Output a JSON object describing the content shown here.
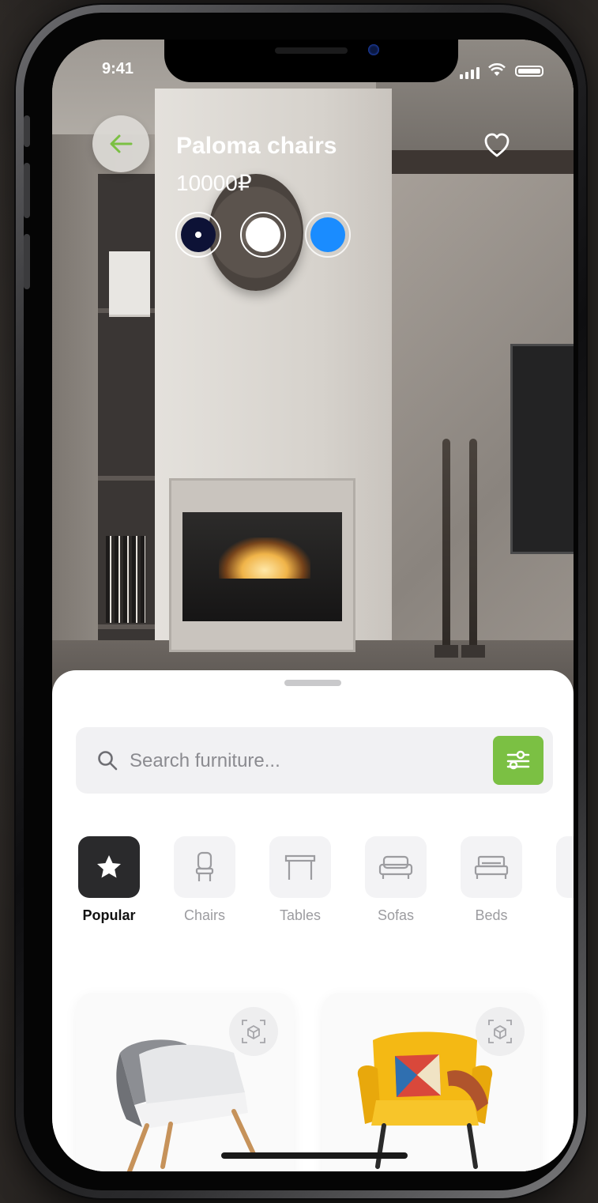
{
  "status_bar": {
    "time": "9:41"
  },
  "product": {
    "title": "Paloma chairs",
    "price": "10000₽",
    "colors": [
      {
        "name": "navy",
        "hex": "#0d1236",
        "selected": true
      },
      {
        "name": "white",
        "hex": "#ffffff",
        "selected": false
      },
      {
        "name": "blue",
        "hex": "#1a8cff",
        "selected": false
      }
    ]
  },
  "search": {
    "placeholder": "Search furniture..."
  },
  "categories": [
    {
      "label": "Popular",
      "icon": "star-icon",
      "active": true
    },
    {
      "label": "Chairs",
      "icon": "chair-icon",
      "active": false
    },
    {
      "label": "Tables",
      "icon": "table-icon",
      "active": false
    },
    {
      "label": "Sofas",
      "icon": "sofa-icon",
      "active": false
    },
    {
      "label": "Beds",
      "icon": "bed-icon",
      "active": false
    }
  ],
  "products": [
    {
      "name": "grey armchair",
      "icon": "ar-view-icon"
    },
    {
      "name": "yellow armchair",
      "icon": "ar-view-icon"
    }
  ],
  "colors": {
    "accent": "#7bc043",
    "dark": "#2a2a2c",
    "light_bg": "#f1f1f3"
  }
}
